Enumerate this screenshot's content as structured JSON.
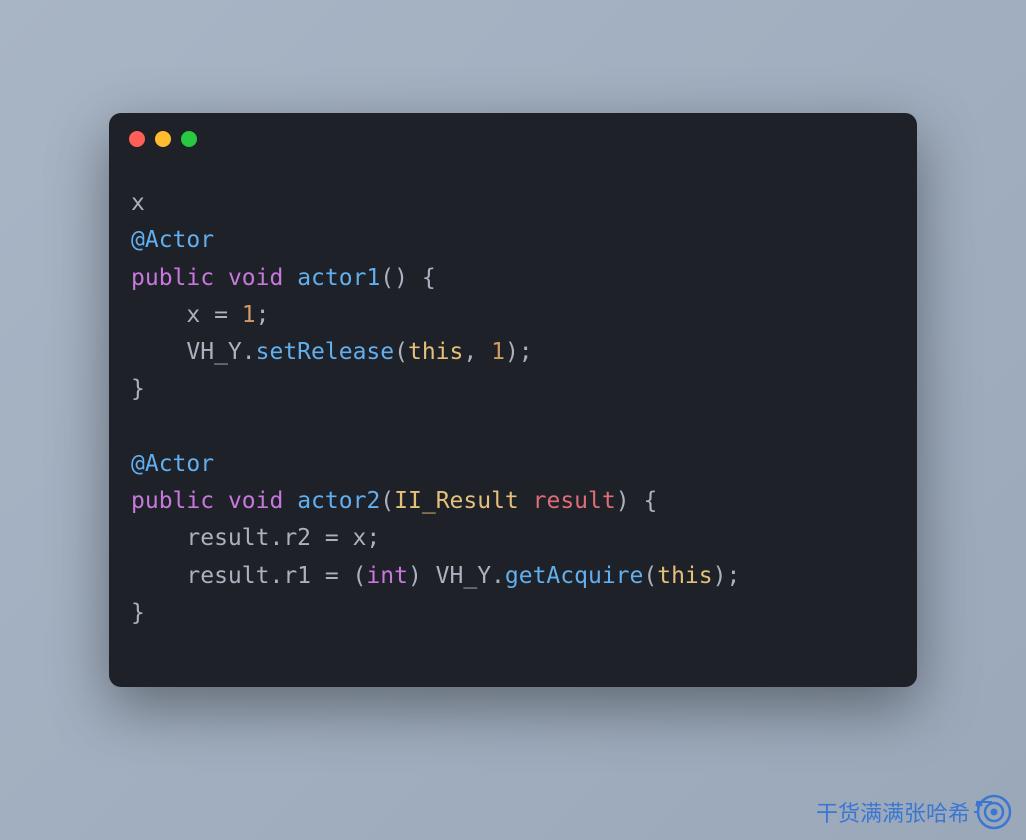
{
  "window": {
    "dots": [
      "red",
      "yellow",
      "green"
    ]
  },
  "code": {
    "line1": "x",
    "annotation": "@Actor",
    "public": "public",
    "void": "void",
    "actor1": "actor1",
    "actor2": "actor2",
    "x_assign_pre": "    x = ",
    "one": "1",
    "semicolon": ";",
    "vhy": "VH_Y",
    "setRelease": "setRelease",
    "getAcquire": "getAcquire",
    "this": "this",
    "close_brace": "}",
    "open_brace": " {",
    "paren_open": "(",
    "paren_close": ")",
    "ii_result": "II_Result",
    "result": "result",
    "r2_assign": "    result.r2 = x;",
    "r1_assign_pre": "    result.r1 = (",
    "int_cast": "int",
    "r1_assign_mid": ") VH_Y.",
    "comma_sp": ", ",
    "indent": "    ",
    "dot": "."
  },
  "watermark": {
    "text": "干货满满张哈希"
  }
}
